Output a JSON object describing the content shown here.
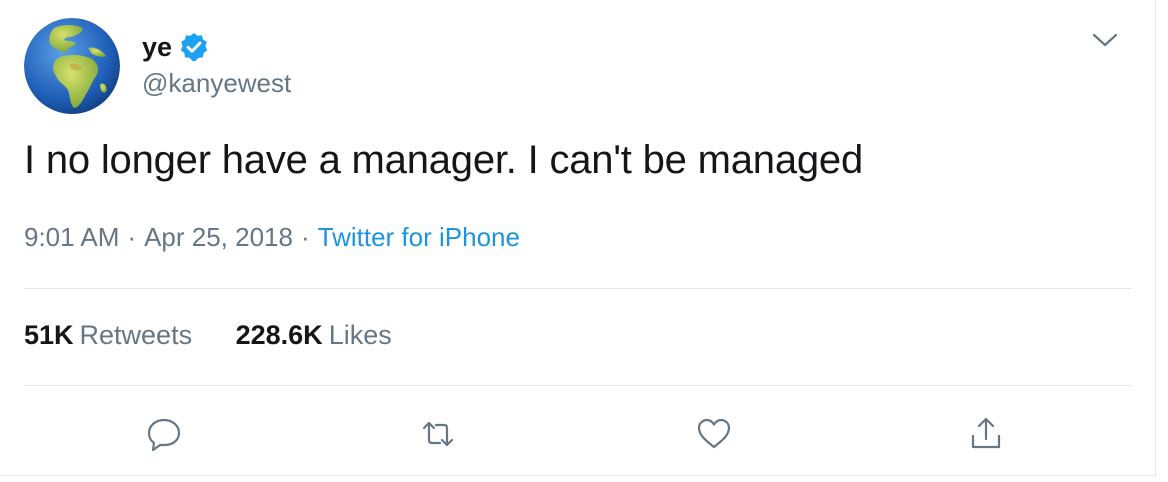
{
  "user": {
    "display_name": "ye",
    "handle": "@kanyewest",
    "verified": true,
    "avatar_icon": "globe-europe-africa-icon"
  },
  "tweet": {
    "text": "I no longer have a manager. I can't be managed",
    "time": "9:01 AM",
    "date": "Apr 25, 2018",
    "separator": "·",
    "source": "Twitter for iPhone"
  },
  "stats": {
    "retweets_count": "51K",
    "retweets_label": "Retweets",
    "likes_count": "228.6K",
    "likes_label": "Likes"
  },
  "actions": [
    "reply-icon",
    "retweet-icon",
    "like-icon",
    "share-icon"
  ],
  "colors": {
    "text": "#14171a",
    "secondary": "#657786",
    "link": "#1b95e0",
    "verified": "#1da1f2",
    "divider": "#e1e8ed"
  }
}
